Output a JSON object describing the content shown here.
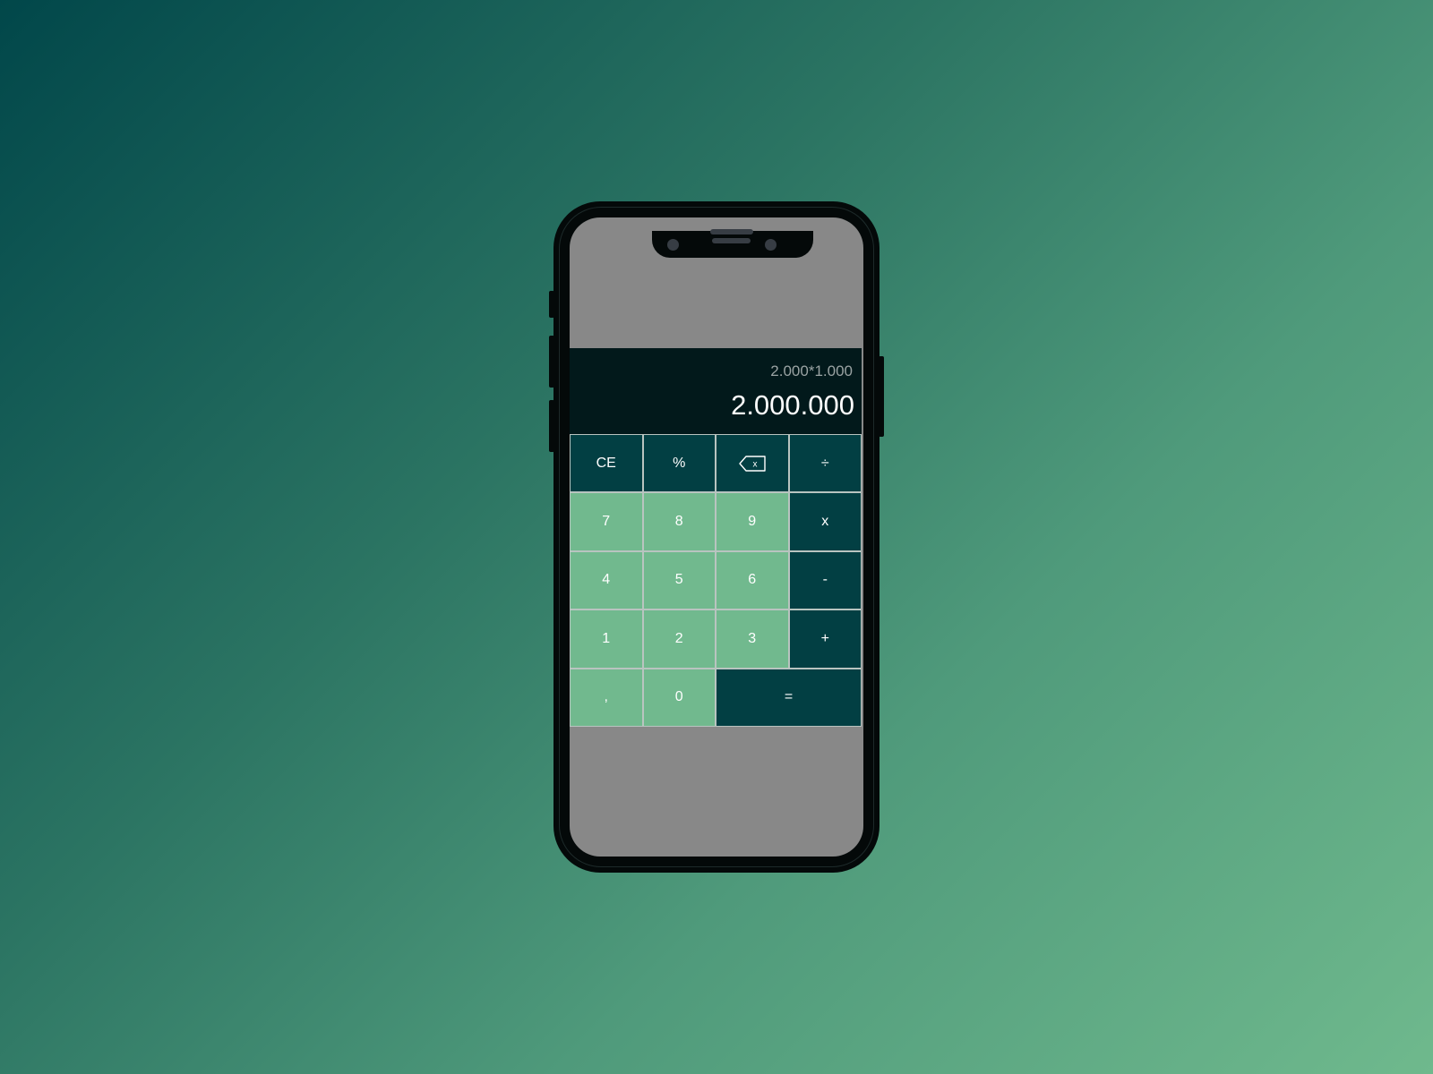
{
  "display": {
    "expression": "2.000*1.000",
    "result": "2.000.000"
  },
  "keys": {
    "ce": "CE",
    "percent": "%",
    "backspace_glyph": "x",
    "divide": "÷",
    "seven": "7",
    "eight": "8",
    "nine": "9",
    "multiply": "x",
    "four": "4",
    "five": "5",
    "six": "6",
    "minus": "-",
    "one": "1",
    "two": "2",
    "three": "3",
    "plus": "+",
    "comma": ",",
    "zero": "0",
    "equals": "="
  },
  "icons": {
    "backspace": "backspace-icon"
  },
  "colors": {
    "operator_key": "#023f43",
    "number_key": "#71b98e",
    "display_bg": "#02191b",
    "screen_bg": "#888888"
  }
}
